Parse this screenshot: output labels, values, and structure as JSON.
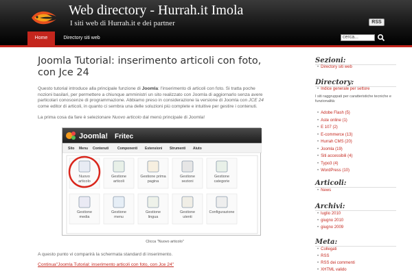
{
  "header": {
    "title": "Web directory - Hurrah.it Imola",
    "description": "I siti web di Hurrah.it e dei partner",
    "rss": "RSS"
  },
  "nav": {
    "items": [
      {
        "label": "Home",
        "active": true
      },
      {
        "label": "Directory siti web",
        "active": false
      }
    ],
    "search_placeholder": "cerca...",
    "accent": "#c4261d"
  },
  "post": {
    "title": "Joomla Tutorial: inserimento articoli con foto, con Jce 24",
    "para1_a": "Questo tutorial introduce alla principale funzione di ",
    "para1_b": "Joomla",
    "para1_c": ": l'inserimento di articoli con foto. Si tratta poche nozioni basilari, per permettere a chiunque amministri un sito realizzato con Joomla di aggiornarlo senza avere particolari conoscenze di programmazione. Abbiamo preso in considerazione la versione di Joomla con ",
    "para1_d": "JCE 24",
    "para1_e": " come editor di articoli, in quanto ci sembra una delle soluzioni più complete e intuitive per gestire i contenuti.",
    "para2_a": "La prima cosa da fare è selezionare ",
    "para2_b": "Nuovo articolo",
    "para2_c": " dal menù principale di Joomla!",
    "caption": "Clicca \"Nuovo articolo\"",
    "para3": "A questo punto vi comparirà la schermata standard di inserimento.",
    "continue_link": "Continua\"Joomla Tutorial: inserimento articoli con foto, con Jce 24\""
  },
  "screenshot": {
    "logo_text": "Joomla!",
    "brand": "Fritec",
    "menu": [
      "Sito",
      "Menu",
      "Contenuti",
      "Componenti",
      "Estensioni",
      "Strumenti",
      "Aiuto"
    ],
    "icons": [
      {
        "label": "Nuovo articolo",
        "icon": "new-article-icon"
      },
      {
        "label": "Gestione articoli",
        "icon": "articles-icon"
      },
      {
        "label": "Gestione prima pagina",
        "icon": "frontpage-icon"
      },
      {
        "label": "Gestione sezioni",
        "icon": "sections-icon"
      },
      {
        "label": "Gestione categorie",
        "icon": "categories-icon"
      },
      {
        "label": "Gestione media",
        "icon": "media-icon"
      },
      {
        "label": "Gestione menu",
        "icon": "menu-icon"
      },
      {
        "label": "Gestione lingua",
        "icon": "language-icon"
      },
      {
        "label": "Gestione utenti",
        "icon": "users-icon"
      },
      {
        "label": "Configurazione",
        "icon": "config-icon"
      }
    ]
  },
  "sidebar": {
    "sezioni_title": "Sezioni:",
    "sezioni": [
      "Directory siti web"
    ],
    "directory_title": "Directory:",
    "directory_main": "Indice generale per settore",
    "directory_note": "I siti raggruppati per caratteristiche tecniche e funzionalità:",
    "directory_items": [
      "Adobe Flash (5)",
      "Aste online (1)",
      "E 107 (2)",
      "E-commerce (13)",
      "Hurrah CMS (20)",
      "Joomla (19)",
      "Siti accessibili (4)",
      "Typo3 (4)",
      "WordPress (10)"
    ],
    "articoli_title": "Articoli:",
    "articoli": [
      "News"
    ],
    "archivi_title": "Archivi:",
    "archivi": [
      "luglio 2010",
      "giugno 2010",
      "giugno 2009"
    ],
    "meta_title": "Meta:",
    "meta": [
      "Collegati",
      "RSS",
      "RSS dei commenti",
      "XHTML valido"
    ]
  }
}
